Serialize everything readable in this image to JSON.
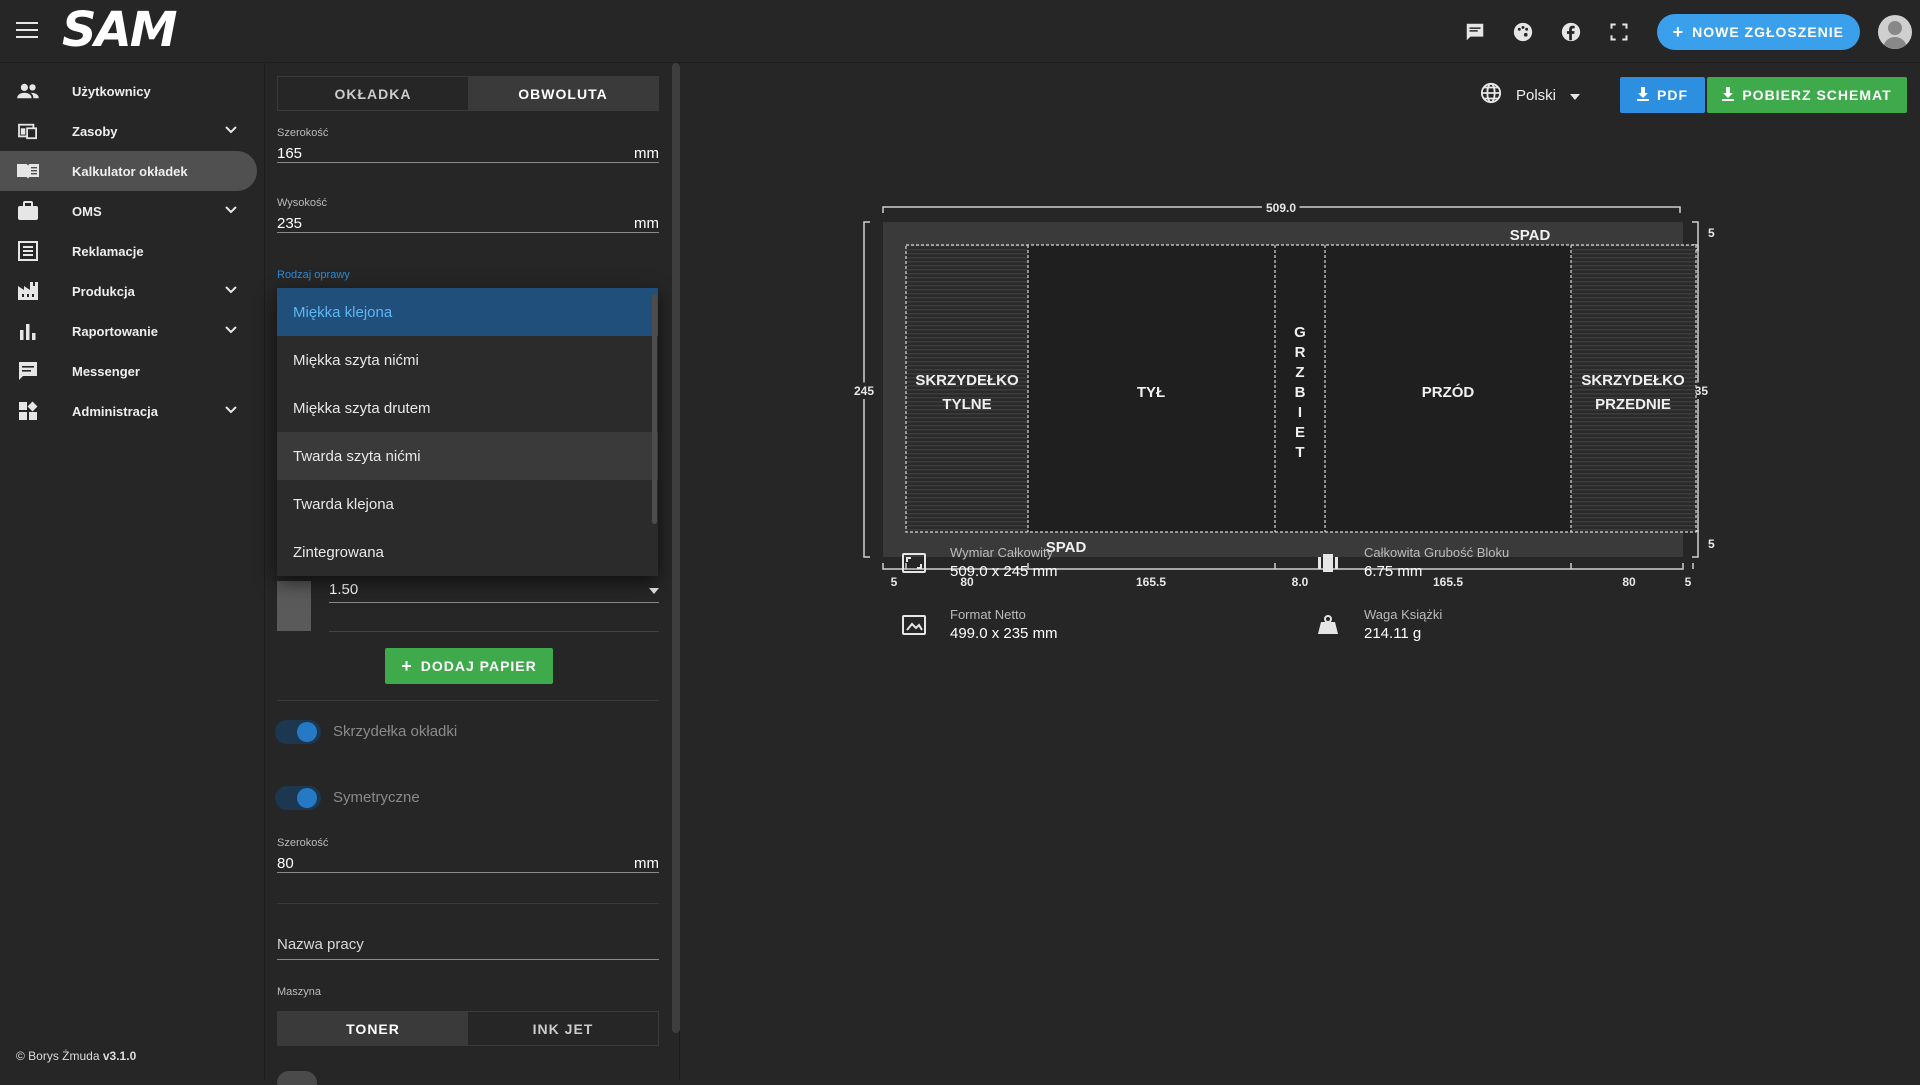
{
  "app": {
    "logo": "SAM",
    "copyright_prefix": "© Borys Żmuda",
    "version": "v3.1.0"
  },
  "topbar": {
    "new_request_label": "NOWE ZGŁOSZENIE",
    "icons": [
      "chat-icon",
      "theme-palette-icon",
      "facebook-icon",
      "fullscreen-icon"
    ]
  },
  "sidebar": {
    "items": [
      {
        "label": "Użytkownicy",
        "icon": "users-icon",
        "expandable": false
      },
      {
        "label": "Zasoby",
        "icon": "resources-icon",
        "expandable": true
      },
      {
        "label": "Kalkulator okładek",
        "icon": "book-icon",
        "expandable": false,
        "active": true
      },
      {
        "label": "OMS",
        "icon": "briefcase-icon",
        "expandable": true
      },
      {
        "label": "Reklamacje",
        "icon": "list-icon",
        "expandable": false
      },
      {
        "label": "Produkcja",
        "icon": "factory-icon",
        "expandable": true
      },
      {
        "label": "Raportowanie",
        "icon": "bar-chart-icon",
        "expandable": true
      },
      {
        "label": "Messenger",
        "icon": "message-icon",
        "expandable": false
      },
      {
        "label": "Administracja",
        "icon": "admin-icon",
        "expandable": true
      }
    ]
  },
  "panel": {
    "tabs": [
      "OKŁADKA",
      "OBWOLUTA"
    ],
    "selected_tab": 1,
    "width": {
      "label": "Szerokość",
      "value": "165",
      "unit": "mm"
    },
    "height": {
      "label": "Wysokość",
      "value": "235",
      "unit": "mm"
    },
    "binding": {
      "label": "Rodzaj oprawy",
      "options": [
        "Miękka klejona",
        "Miękka szyta nićmi",
        "Miękka szyta drutem",
        "Twarda szyta nićmi",
        "Twarda klejona",
        "Zintegrowana"
      ],
      "selected": 0,
      "hovered": 3
    },
    "paper_value": "1.50",
    "add_paper_label": "DODAJ PAPIER",
    "toggle_flaps": "Skrzydełka okładki",
    "toggle_symmetric": "Symetryczne",
    "flap_width": {
      "label": "Szerokość",
      "value": "80",
      "unit": "mm"
    },
    "job_name_placeholder": "Nazwa pracy",
    "machine": {
      "label": "Maszyna",
      "options": [
        "TONER",
        "INK JET"
      ],
      "selected": 0
    }
  },
  "main": {
    "language": "Polski",
    "pdf_label": "PDF",
    "schema_label": "POBIERZ SCHEMAT",
    "diagram": {
      "total_width": "509.0",
      "left_height": "245",
      "right_height": "235",
      "bleed_top": "5",
      "bleed_bottom": "5",
      "spad_top": "SPAD",
      "spad_bottom": "SPAD",
      "panels": {
        "flap_back_1": "SKRZYDEŁKO",
        "flap_back_2": "TYLNE",
        "back": "TYŁ",
        "spine": [
          "G",
          "R",
          "Z",
          "B",
          "I",
          "E",
          "T"
        ],
        "front": "PRZÓD",
        "flap_front_1": "SKRZYDEŁKO",
        "flap_front_2": "PRZEDNIE"
      },
      "bottom_dims": [
        "5",
        "80",
        "165.5",
        "8.0",
        "165.5",
        "80",
        "5"
      ]
    },
    "info": {
      "total_size": {
        "label": "Wymiar Całkowity",
        "value": "509.0 x 245 mm"
      },
      "net_format": {
        "label": "Format Netto",
        "value": "499.0 x 235 mm"
      },
      "block_thickness": {
        "label": "Całkowita Grubość Bloku",
        "value": "6.75 mm"
      },
      "book_weight": {
        "label": "Waga Książki",
        "value": "214.11 g"
      }
    }
  }
}
